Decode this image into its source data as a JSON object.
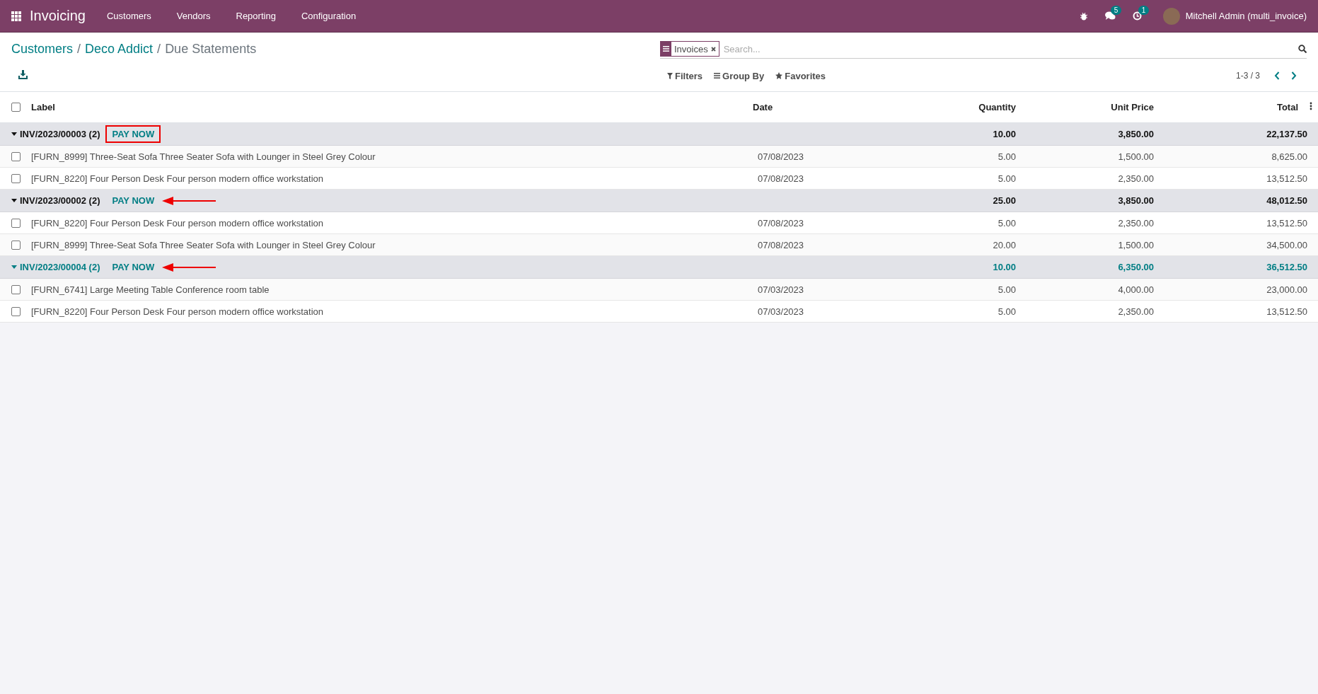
{
  "navbar": {
    "app_name": "Invoicing",
    "menu": [
      "Customers",
      "Vendors",
      "Reporting",
      "Configuration"
    ],
    "messages_badge": "5",
    "activities_badge": "1",
    "user": "Mitchell Admin (multi_invoice)"
  },
  "breadcrumb": {
    "separator": "/",
    "items": [
      {
        "label": "Customers",
        "link": true
      },
      {
        "label": "Deco Addict",
        "link": true
      },
      {
        "label": "Due Statements",
        "link": false
      }
    ]
  },
  "search": {
    "facets": [
      "Invoices"
    ],
    "placeholder": "Search..."
  },
  "search_options": [
    "Filters",
    "Group By",
    "Favorites"
  ],
  "pager": "1-3 / 3",
  "table": {
    "all_checked": false,
    "columns": [
      "Label",
      "Date",
      "Quantity",
      "Unit Price",
      "Total"
    ],
    "groups": [
      {
        "name": "INV/2023/00003 (2)",
        "action": "PAY NOW",
        "kind": "boxed",
        "highlighted": false,
        "expanded": true,
        "quantity": "10.00",
        "unit_price": "3,850.00",
        "total": "22,137.50",
        "rows": [
          {
            "label": "[FURN_8999] Three-Seat Sofa Three Seater Sofa with Lounger in Steel Grey Colour",
            "date": "07/08/2023",
            "quantity": "5.00",
            "unit_price": "1,500.00",
            "total": "8,625.00",
            "checked": false
          },
          {
            "label": "[FURN_8220] Four Person Desk Four person modern office workstation",
            "date": "07/08/2023",
            "quantity": "5.00",
            "unit_price": "2,350.00",
            "total": "13,512.50",
            "checked": false
          }
        ]
      },
      {
        "name": "INV/2023/00002 (2)",
        "action": "PAY NOW",
        "kind": "arrowed",
        "highlighted": false,
        "expanded": true,
        "quantity": "25.00",
        "unit_price": "3,850.00",
        "total": "48,012.50",
        "rows": [
          {
            "label": "[FURN_8220] Four Person Desk Four person modern office workstation",
            "date": "07/08/2023",
            "quantity": "5.00",
            "unit_price": "2,350.00",
            "total": "13,512.50",
            "checked": false
          },
          {
            "label": "[FURN_8999] Three-Seat Sofa Three Seater Sofa with Lounger in Steel Grey Colour",
            "date": "07/08/2023",
            "quantity": "20.00",
            "unit_price": "1,500.00",
            "total": "34,500.00",
            "checked": false
          }
        ]
      },
      {
        "name": "INV/2023/00004 (2)",
        "action": "PAY NOW",
        "kind": "arrowed",
        "highlighted": true,
        "expanded": true,
        "quantity": "10.00",
        "unit_price": "6,350.00",
        "total": "36,512.50",
        "rows": [
          {
            "label": "[FURN_6741] Large Meeting Table Conference room table",
            "date": "07/03/2023",
            "quantity": "5.00",
            "unit_price": "4,000.00",
            "total": "23,000.00",
            "checked": false
          },
          {
            "label": "[FURN_8220] Four Person Desk Four person modern office workstation",
            "date": "07/03/2023",
            "quantity": "5.00",
            "unit_price": "2,350.00",
            "total": "13,512.50",
            "checked": false
          }
        ]
      }
    ]
  }
}
